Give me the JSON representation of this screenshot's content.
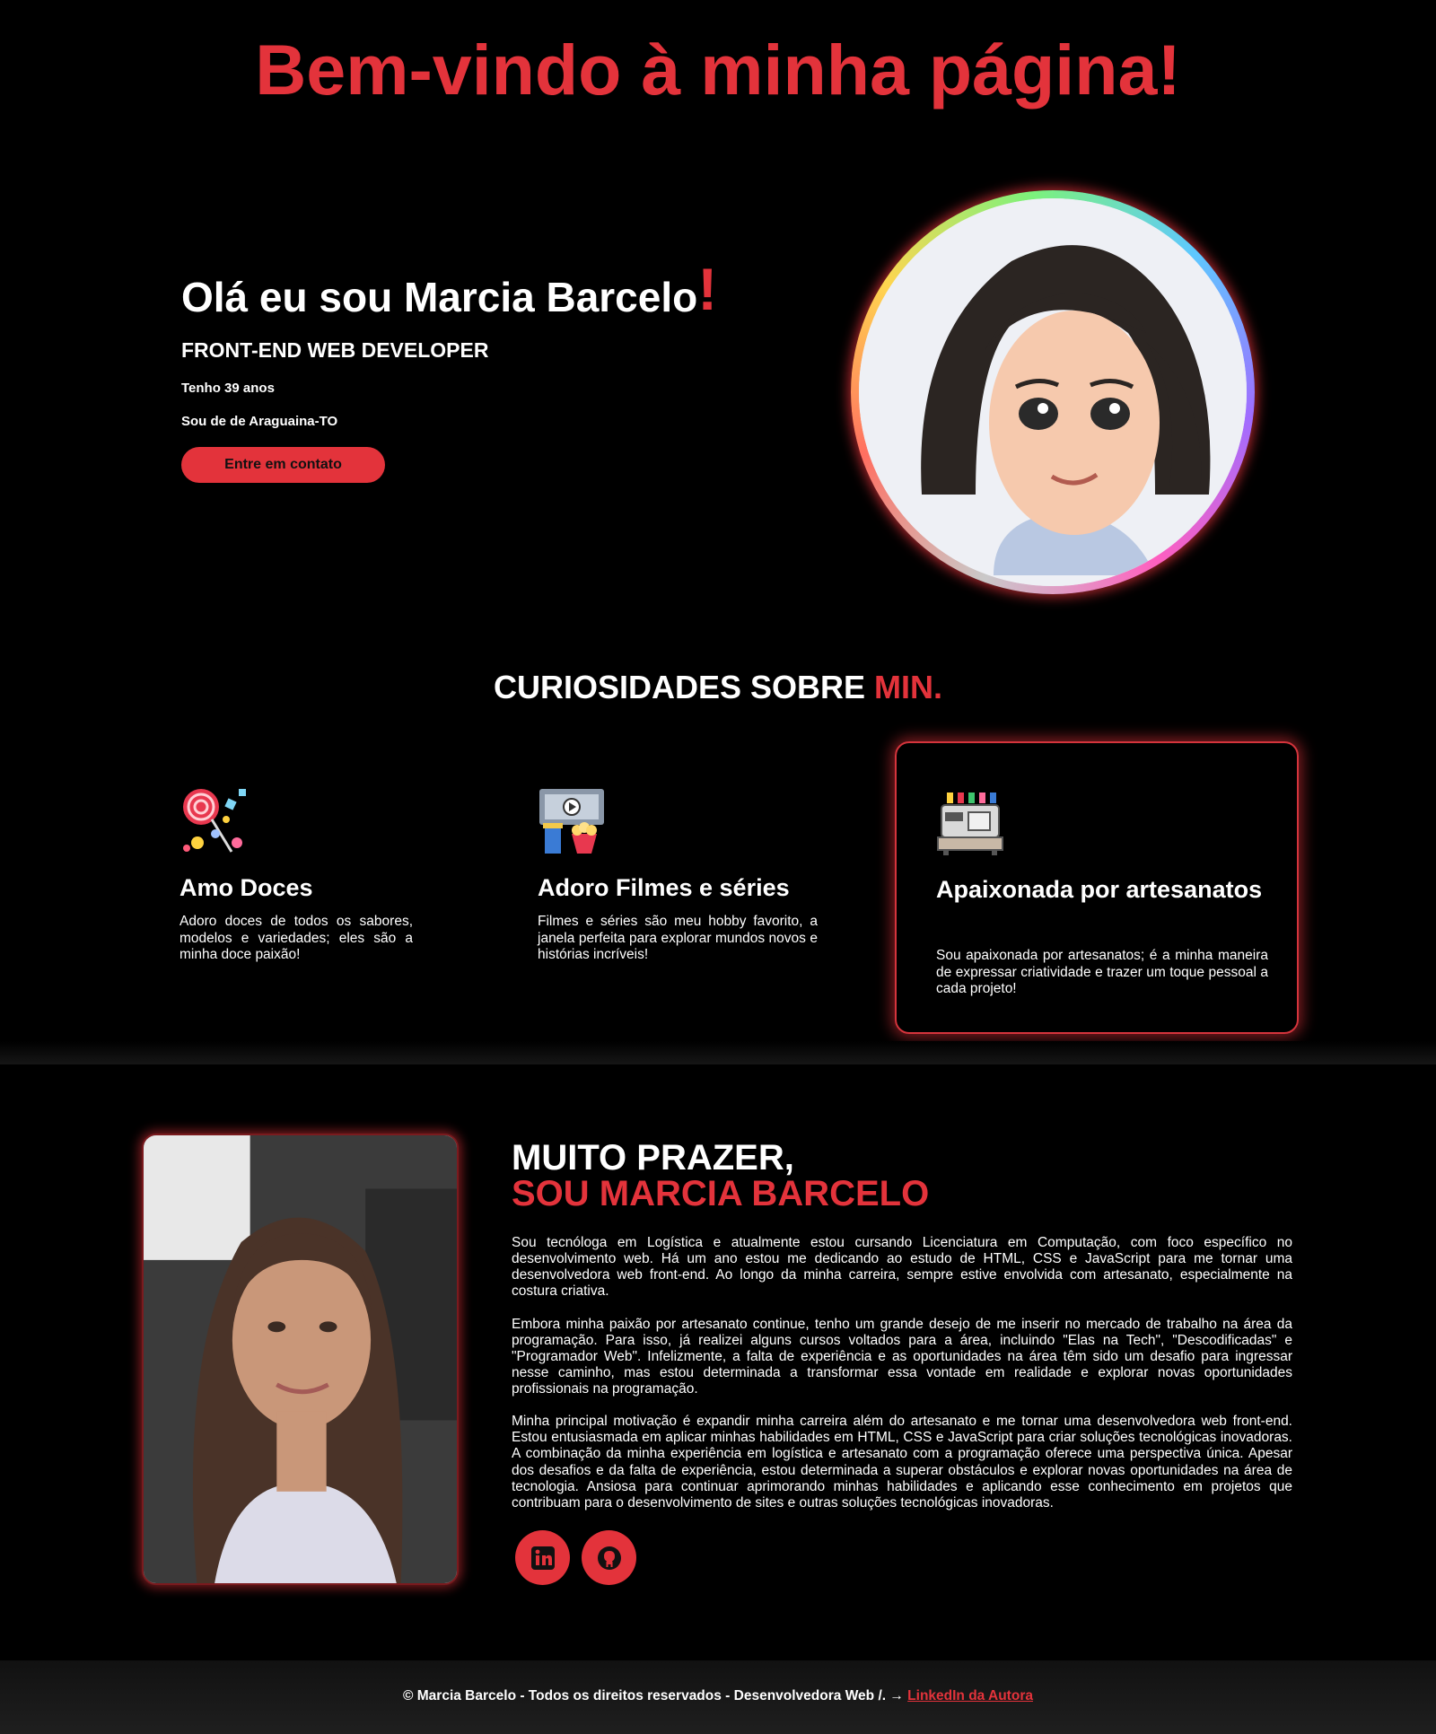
{
  "header": {
    "title": "Bem-vindo à minha página!"
  },
  "hero": {
    "greeting": "Olá eu sou Marcia Barcelo",
    "exclamation": "!",
    "role": "FRONT-END WEB DEVELOPER",
    "age": "Tenho 39 anos",
    "city": "Sou de de Araguaina-TO",
    "contact_button": "Entre em contato"
  },
  "curiosities": {
    "title": "CURIOSIDADES SOBRE",
    "title_accent": "MIN.",
    "cards": [
      {
        "icon": "candy-icon",
        "title": "Amo Doces",
        "text": "Adoro doces de todos os sabores, modelos e variedades; eles são a minha doce paixão!"
      },
      {
        "icon": "movies-icon",
        "title": "Adoro Filmes e séries",
        "text": "Filmes e séries são meu hobby favorito, a janela perfeita para explorar mundos novos e histórias incríveis!"
      },
      {
        "icon": "sewing-machine-icon",
        "title": "Apaixonada por artesanatos",
        "text": "Sou apaixonada por artesanatos; é a minha maneira de expressar criatividade e trazer um toque pessoal a cada projeto!"
      }
    ]
  },
  "about": {
    "heading_line1": "MUITO PRAZER,",
    "heading_line2": "SOU MARCIA BARCELO",
    "paragraphs": [
      "Sou tecnóloga em Logística e atualmente estou cursando Licenciatura em Computação, com foco específico no desenvolvimento web. Há um ano estou me dedicando ao estudo de HTML, CSS e JavaScript para me tornar uma desenvolvedora web front-end. Ao longo da minha carreira, sempre estive envolvida com artesanato, especialmente na costura criativa.",
      "Embora minha paixão por artesanato continue, tenho um grande desejo de me inserir no mercado de trabalho na área da programação. Para isso, já realizei alguns cursos voltados para a área, incluindo \"Elas na Tech\", \"Descodificadas\" e \"Programador Web\". Infelizmente, a falta de experiência e as oportunidades na área têm sido um desafio para ingressar nesse caminho, mas estou determinada a transformar essa vontade em realidade e explorar novas oportunidades profissionais na programação.",
      "Minha principal motivação é expandir minha carreira além do artesanato e me tornar uma desenvolvedora web front-end. Estou entusiasmada em aplicar minhas habilidades em HTML, CSS e JavaScript para criar soluções tecnológicas inovadoras. A combinação da minha experiência em logística e artesanato com a programação oferece uma perspectiva única. Apesar dos desafios e da falta de experiência, estou determinada a superar obstáculos e explorar novas oportunidades na área de tecnologia. Ansiosa para continuar aprimorando minhas habilidades e aplicando esse conhecimento em projetos que contribuam para o desenvolvimento de sites e outras soluções tecnológicas inovadoras."
    ],
    "social": [
      {
        "icon": "linkedin-icon"
      },
      {
        "icon": "github-icon"
      }
    ]
  },
  "footer": {
    "text": "© Marcia Barcelo - Todos os direitos reservados - Desenvolvedora Web /. → ",
    "link_label": "LinkedIn da Autora"
  },
  "colors": {
    "accent": "#e3333b",
    "background": "#000000",
    "text": "#ffffff"
  }
}
